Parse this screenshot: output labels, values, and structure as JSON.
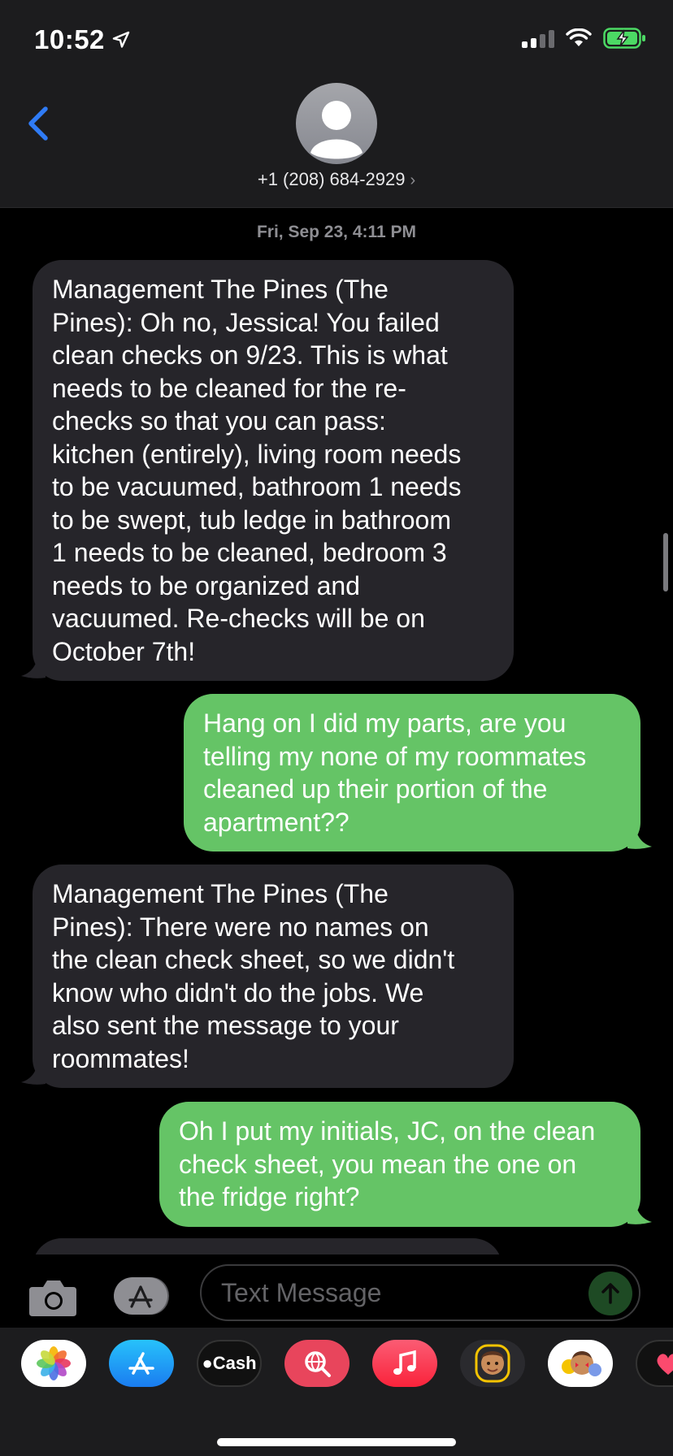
{
  "status_bar": {
    "time": "10:52",
    "battery_color": "#4cd964"
  },
  "header": {
    "contact_number": "+1 (208) 684-2929",
    "contact_chevron": "›"
  },
  "conversation": {
    "timestamp": "Fri, Sep 23, 4:11 PM",
    "messages": [
      {
        "direction": "incoming",
        "lines": [
          "Management The Pines (The",
          "Pines): Oh no, Jessica! You failed",
          "clean checks on 9/23. This is what",
          "needs to be cleaned for the re-",
          "checks so that you can pass:",
          "kitchen (entirely), living room needs",
          "to be vacuumed, bathroom 1 needs",
          "to be swept, tub ledge in bathroom",
          "1 needs to be cleaned, bedroom 3",
          "needs to be organized and",
          "vacuumed. Re-checks will be on",
          "October 7th!"
        ]
      },
      {
        "direction": "outgoing",
        "lines": [
          "Hang on I did my parts, are you",
          "telling my none of my roommates",
          "cleaned up their portion of the",
          "apartment??"
        ]
      },
      {
        "direction": "incoming",
        "lines": [
          "Management The Pines (The",
          "Pines): There were no names on",
          "the clean check sheet, so we didn't",
          "know who didn't do the jobs. We",
          "also sent the message to your",
          "roommates!"
        ]
      },
      {
        "direction": "outgoing",
        "lines": [
          "Oh I put my initials, JC, on the clean",
          "check sheet, you mean the one on",
          "the fridge right?"
        ]
      }
    ]
  },
  "input_bar": {
    "placeholder": "Text Message"
  },
  "app_drawer": {
    "apps": [
      {
        "icon": "photos-icon"
      },
      {
        "icon": "app-store-icon"
      },
      {
        "icon": "apple-cash-icon",
        "label": "Cash"
      },
      {
        "icon": "web-images-search-icon"
      },
      {
        "icon": "music-icon"
      },
      {
        "icon": "memoji-icon"
      },
      {
        "icon": "animoji-stickers-icon"
      },
      {
        "icon": "digital-touch-icon"
      }
    ]
  },
  "colors": {
    "incoming_bubble": "#26252a",
    "outgoing_bubble": "#65c466",
    "accent_blue": "#2f7bf5"
  }
}
